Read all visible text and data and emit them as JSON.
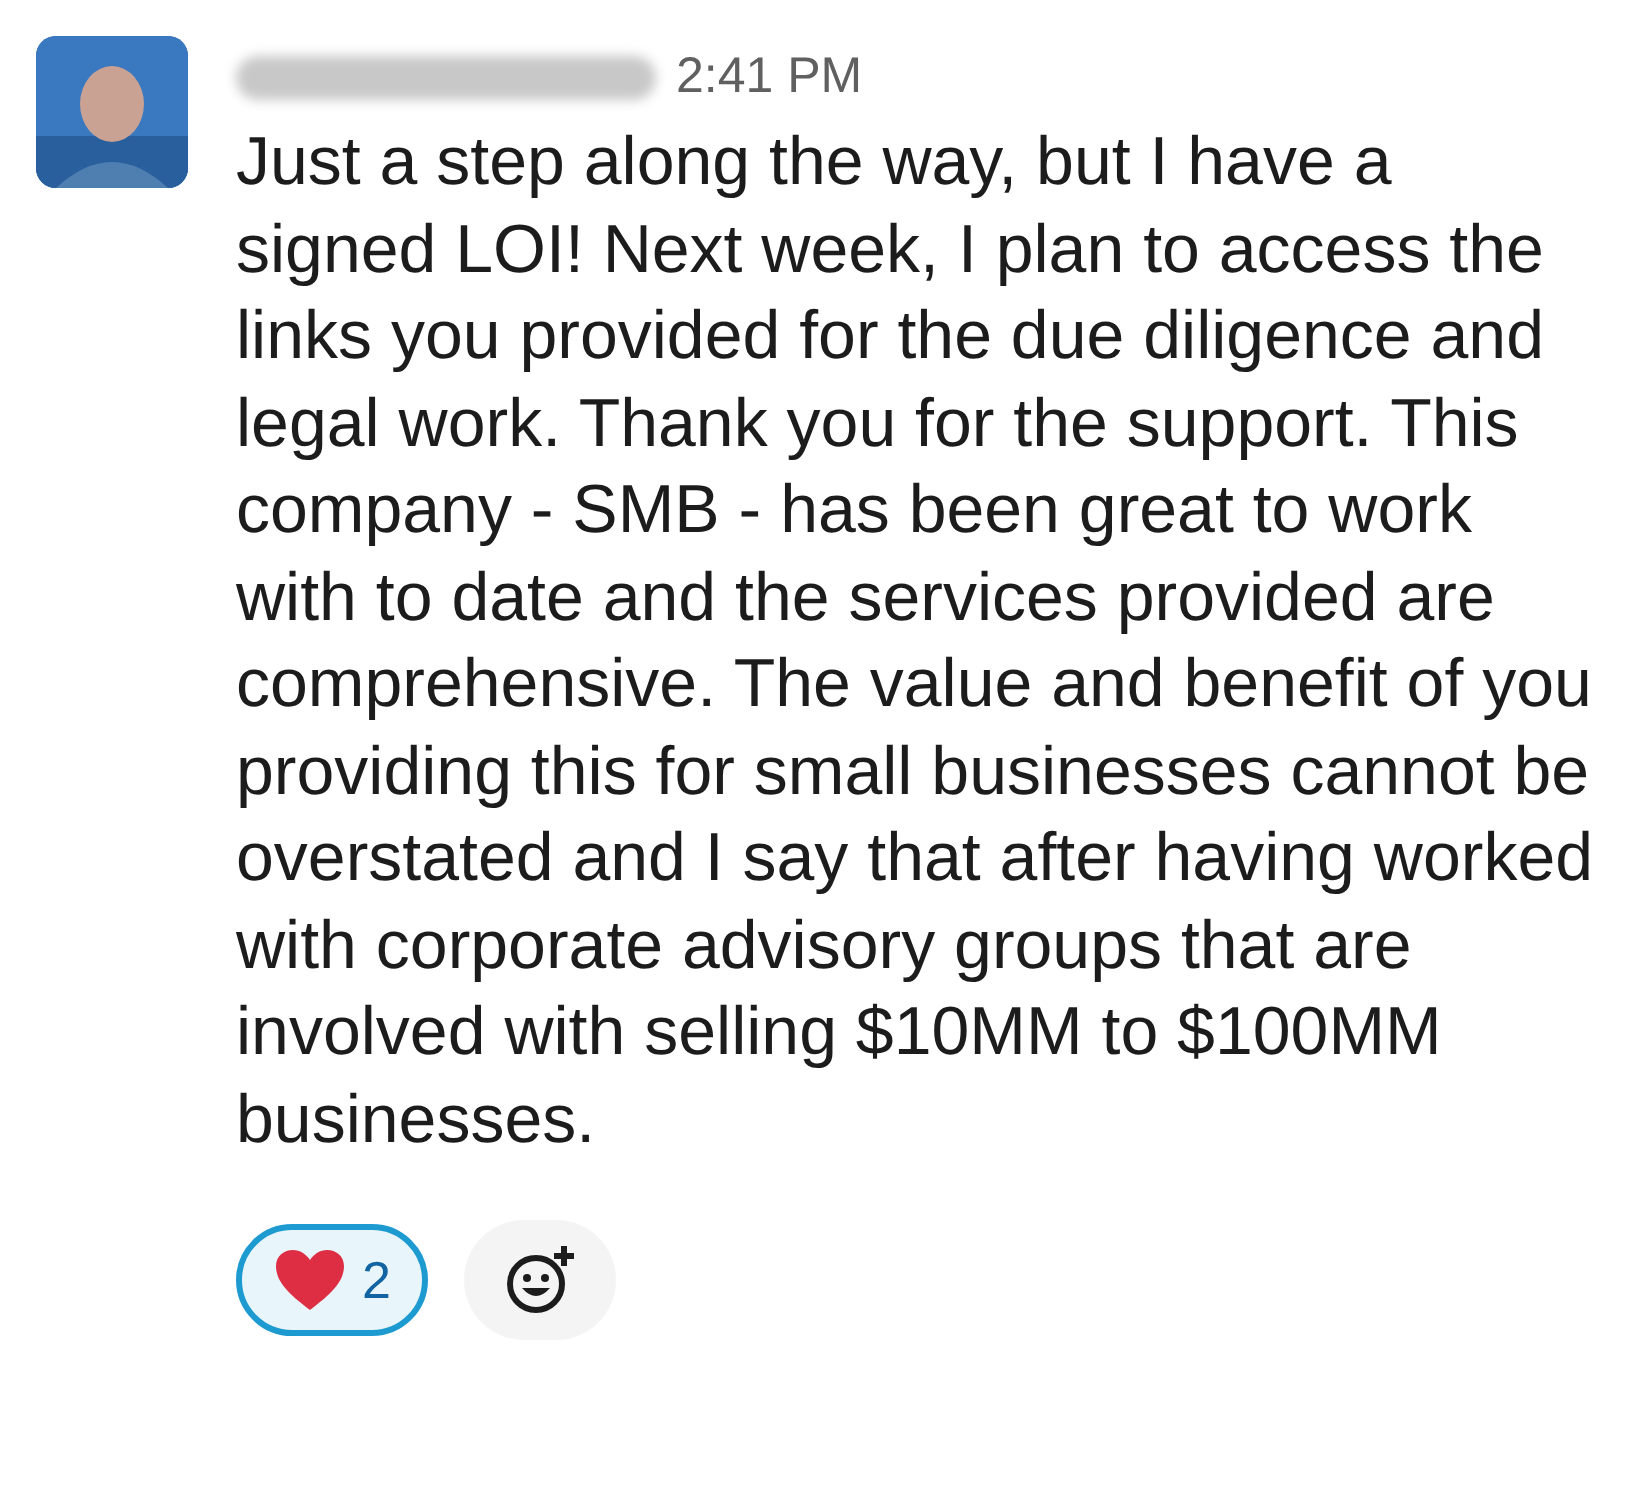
{
  "message": {
    "time": "2:41 PM",
    "text": "Just a step along the way, but I have a signed LOI! Next week, I plan to access the links you provided for the due diligence and legal work. Thank you for the support. This company - SMB - has been great to work with to date and the services provided are comprehensive. The value and benefit of you providing this for small businesses cannot be overstated and I say that after having worked with corporate advisory groups that are involved with selling $10MM to $100MM businesses."
  },
  "reactions": [
    {
      "count": "2",
      "selected": true
    }
  ]
}
